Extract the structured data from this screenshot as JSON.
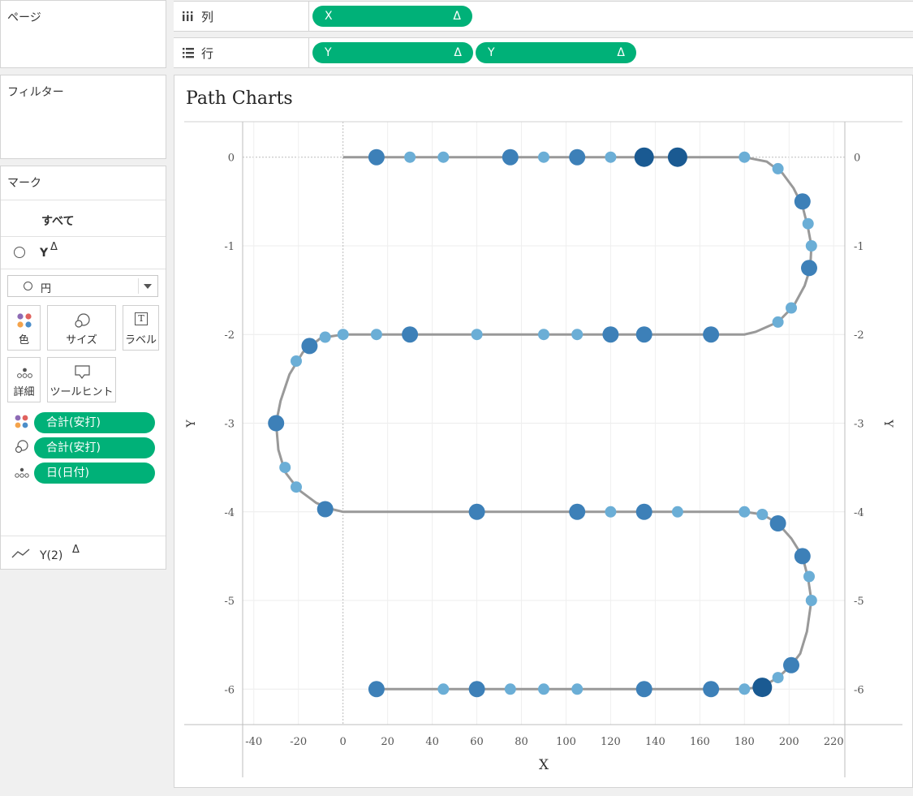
{
  "left": {
    "pages_label": "ページ",
    "filters_label": "フィルター",
    "marks_label": "マーク",
    "all_label": "すべて",
    "y_label": "Y",
    "y_delta": "Δ",
    "mark_type": "円",
    "cards": {
      "color": "色",
      "size": "サイズ",
      "label_text": "ラベル",
      "label_icon": "T",
      "detail": "詳細",
      "tooltip": "ツールヒント"
    },
    "fields": {
      "color_field": "合計(安打)",
      "size_field": "合計(安打)",
      "detail_field": "日(日付)"
    },
    "y2_label": "Y(2)",
    "y2_delta": "Δ"
  },
  "shelves": {
    "columns_label": "列",
    "rows_label": "行",
    "col_pill": "X",
    "row_pill_1": "Y",
    "row_pill_2": "Y",
    "delta": "Δ"
  },
  "icons": {
    "columns": "columns-icon",
    "rows": "rows-icon",
    "circle": "circle-icon",
    "dropdown": "chevron-down-icon",
    "color": "color-dots-icon",
    "size": "size-circles-icon",
    "label": "label-t-icon",
    "detail": "detail-dots-icon",
    "tooltip": "tooltip-bubble-icon",
    "line": "line-icon"
  },
  "colors": {
    "accent": "#00b178",
    "light_blue": "#6baed6",
    "mid_blue": "#3d80b8",
    "dark_blue": "#1a5a92",
    "path": "#999999"
  },
  "chart_data": {
    "type": "scatter",
    "title": "Path Charts",
    "xlabel": "X",
    "ylabel": "Y",
    "ylabel_right": "Y",
    "xlim": [
      -45,
      225
    ],
    "ylim": [
      -6.4,
      0.4
    ],
    "xticks": [
      "-40",
      "-20",
      "0",
      "20",
      "40",
      "60",
      "80",
      "100",
      "120",
      "140",
      "160",
      "180",
      "200",
      "220"
    ],
    "yticks": [
      "0",
      "-1",
      "-2",
      "-3",
      "-4",
      "-5",
      "-6"
    ],
    "grid": true,
    "path": [
      [
        0,
        0
      ],
      [
        180,
        0
      ],
      [
        190,
        -0.05
      ],
      [
        197,
        -0.18
      ],
      [
        202,
        -0.35
      ],
      [
        206,
        -0.55
      ],
      [
        208.5,
        -0.8
      ],
      [
        210,
        -1
      ],
      [
        209.5,
        -1.25
      ],
      [
        207,
        -1.45
      ],
      [
        202,
        -1.68
      ],
      [
        195,
        -1.86
      ],
      [
        185,
        -1.97
      ],
      [
        180,
        -2
      ],
      [
        0,
        -2
      ],
      [
        -10,
        -2.04
      ],
      [
        -18,
        -2.2
      ],
      [
        -24,
        -2.45
      ],
      [
        -28,
        -2.75
      ],
      [
        -30,
        -3
      ],
      [
        -29,
        -3.3
      ],
      [
        -26,
        -3.55
      ],
      [
        -20,
        -3.75
      ],
      [
        -12,
        -3.9
      ],
      [
        -5,
        -3.97
      ],
      [
        0,
        -4
      ],
      [
        180,
        -4
      ],
      [
        188,
        -4.03
      ],
      [
        195,
        -4.13
      ],
      [
        201,
        -4.3
      ],
      [
        206,
        -4.5
      ],
      [
        208.5,
        -4.75
      ],
      [
        210,
        -5
      ],
      [
        208,
        -5.35
      ],
      [
        205,
        -5.6
      ],
      [
        201,
        -5.73
      ],
      [
        195,
        -5.87
      ],
      [
        188,
        -5.97
      ],
      [
        180,
        -6
      ],
      [
        15,
        -6
      ]
    ],
    "points": [
      {
        "x": 15,
        "y": 0,
        "hits": 2
      },
      {
        "x": 30,
        "y": 0,
        "hits": 1
      },
      {
        "x": 45,
        "y": 0,
        "hits": 1
      },
      {
        "x": 75,
        "y": 0,
        "hits": 2
      },
      {
        "x": 90,
        "y": 0,
        "hits": 1
      },
      {
        "x": 105,
        "y": 0,
        "hits": 2
      },
      {
        "x": 120,
        "y": 0,
        "hits": 1
      },
      {
        "x": 135,
        "y": 0,
        "hits": 3
      },
      {
        "x": 150,
        "y": 0,
        "hits": 3
      },
      {
        "x": 180,
        "y": 0,
        "hits": 1
      },
      {
        "x": 195,
        "y": -0.13,
        "hits": 1
      },
      {
        "x": 206,
        "y": -0.5,
        "hits": 2
      },
      {
        "x": 208.5,
        "y": -0.75,
        "hits": 1
      },
      {
        "x": 210,
        "y": -1,
        "hits": 1
      },
      {
        "x": 209,
        "y": -1.25,
        "hits": 2
      },
      {
        "x": 201,
        "y": -1.7,
        "hits": 1
      },
      {
        "x": 195,
        "y": -1.86,
        "hits": 1
      },
      {
        "x": 165,
        "y": -2,
        "hits": 2
      },
      {
        "x": 135,
        "y": -2,
        "hits": 2
      },
      {
        "x": 120,
        "y": -2,
        "hits": 2
      },
      {
        "x": 105,
        "y": -2,
        "hits": 1
      },
      {
        "x": 90,
        "y": -2,
        "hits": 1
      },
      {
        "x": 60,
        "y": -2,
        "hits": 1
      },
      {
        "x": 30,
        "y": -2,
        "hits": 2
      },
      {
        "x": 15,
        "y": -2,
        "hits": 1
      },
      {
        "x": 0,
        "y": -2,
        "hits": 1
      },
      {
        "x": -8,
        "y": -2.03,
        "hits": 1
      },
      {
        "x": -15,
        "y": -2.13,
        "hits": 2
      },
      {
        "x": -21,
        "y": -2.3,
        "hits": 1
      },
      {
        "x": -30,
        "y": -3,
        "hits": 2
      },
      {
        "x": -26,
        "y": -3.5,
        "hits": 1
      },
      {
        "x": -21,
        "y": -3.72,
        "hits": 1
      },
      {
        "x": -8,
        "y": -3.97,
        "hits": 2
      },
      {
        "x": 60,
        "y": -4,
        "hits": 2
      },
      {
        "x": 105,
        "y": -4,
        "hits": 2
      },
      {
        "x": 120,
        "y": -4,
        "hits": 1
      },
      {
        "x": 135,
        "y": -4,
        "hits": 2
      },
      {
        "x": 150,
        "y": -4,
        "hits": 1
      },
      {
        "x": 180,
        "y": -4,
        "hits": 1
      },
      {
        "x": 188,
        "y": -4.03,
        "hits": 1
      },
      {
        "x": 195,
        "y": -4.13,
        "hits": 2
      },
      {
        "x": 206,
        "y": -4.5,
        "hits": 2
      },
      {
        "x": 209,
        "y": -4.73,
        "hits": 1
      },
      {
        "x": 210,
        "y": -5,
        "hits": 1
      },
      {
        "x": 201,
        "y": -5.73,
        "hits": 2
      },
      {
        "x": 195,
        "y": -5.87,
        "hits": 1
      },
      {
        "x": 188,
        "y": -5.98,
        "hits": 3
      },
      {
        "x": 180,
        "y": -6,
        "hits": 1
      },
      {
        "x": 165,
        "y": -6,
        "hits": 2
      },
      {
        "x": 135,
        "y": -6,
        "hits": 2
      },
      {
        "x": 105,
        "y": -6,
        "hits": 1
      },
      {
        "x": 90,
        "y": -6,
        "hits": 1
      },
      {
        "x": 75,
        "y": -6,
        "hits": 1
      },
      {
        "x": 60,
        "y": -6,
        "hits": 2
      },
      {
        "x": 45,
        "y": -6,
        "hits": 1
      },
      {
        "x": 15,
        "y": -6,
        "hits": 2
      }
    ]
  }
}
